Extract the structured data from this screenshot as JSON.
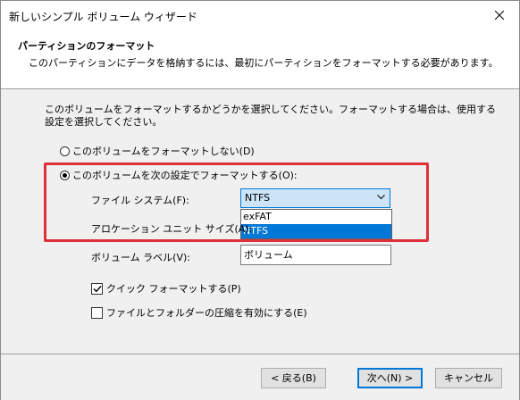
{
  "window": {
    "title": "新しいシンプル ボリューム ウィザード"
  },
  "header": {
    "title": "パーティションのフォーマット",
    "description": "このパーティションにデータを格納するには、最初にパーティションをフォーマットする必要があります。"
  },
  "instructions": "このボリュームをフォーマットするかどうかを選択してください。フォーマットする場合は、使用する設定を選択してください。",
  "options": {
    "no_format": {
      "label": "このボリュームをフォーマットしない(D)",
      "checked": false
    },
    "format": {
      "label": "このボリュームを次の設定でフォーマットする(O):",
      "checked": true
    }
  },
  "filesystem": {
    "label": "ファイル システム(F):",
    "value": "NTFS",
    "options": [
      "exFAT",
      "NTFS"
    ],
    "selected_index": 1
  },
  "allocation": {
    "label": "アロケーション ユニット サイズ(A):"
  },
  "volume_label": {
    "label": "ボリューム ラベル(V):",
    "value": "ボリューム"
  },
  "quick_format": {
    "label": "クイック フォーマットする(P)",
    "checked": true
  },
  "compression": {
    "label": "ファイルとフォルダーの圧縮を有効にする(E)",
    "checked": false
  },
  "buttons": {
    "back": "< 戻る(B)",
    "next": "次へ(N) >",
    "cancel": "キャンセル"
  },
  "colors": {
    "accent": "#0078d7",
    "highlight_border": "#e0303a"
  }
}
